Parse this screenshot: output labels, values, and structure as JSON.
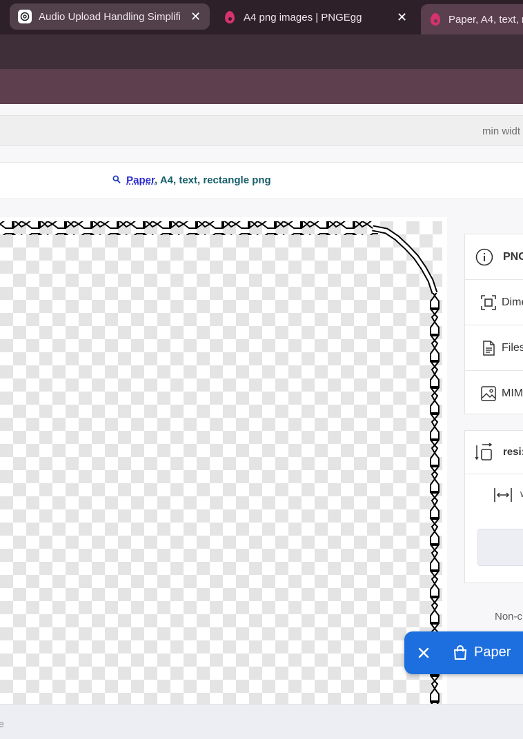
{
  "browser": {
    "tabs": [
      {
        "title": "Audio Upload Handling Simplifi",
        "favicon": "chatgpt-icon",
        "active": false
      },
      {
        "title": "A4 png images | PNGEgg",
        "favicon": "pngegg-icon",
        "active": false
      },
      {
        "title": "Paper, A4, text, r",
        "favicon": "pngegg-icon",
        "active": true
      }
    ],
    "close_glyph": "✕"
  },
  "filter": {
    "label": "min widt"
  },
  "breadcrumb": {
    "link_text": "Paper",
    "rest_text": ", A4, text, rectangle png",
    "icon": "search-icon"
  },
  "info_panel": {
    "header": "PNG",
    "dimensions_label": "Dime",
    "filesize_label": "Files",
    "mime_label": "MIM"
  },
  "resize_panel": {
    "header": "resi:",
    "width_label": "w"
  },
  "notice": {
    "text": "Non-c"
  },
  "status_bar": {
    "text": "e"
  },
  "fab": {
    "label": "Paper",
    "color": "#1d6fe0"
  },
  "colors": {
    "accent": "#1d6fe0",
    "tab_bar": "#2e2029",
    "bookmark_bar": "#5d3f4d"
  }
}
